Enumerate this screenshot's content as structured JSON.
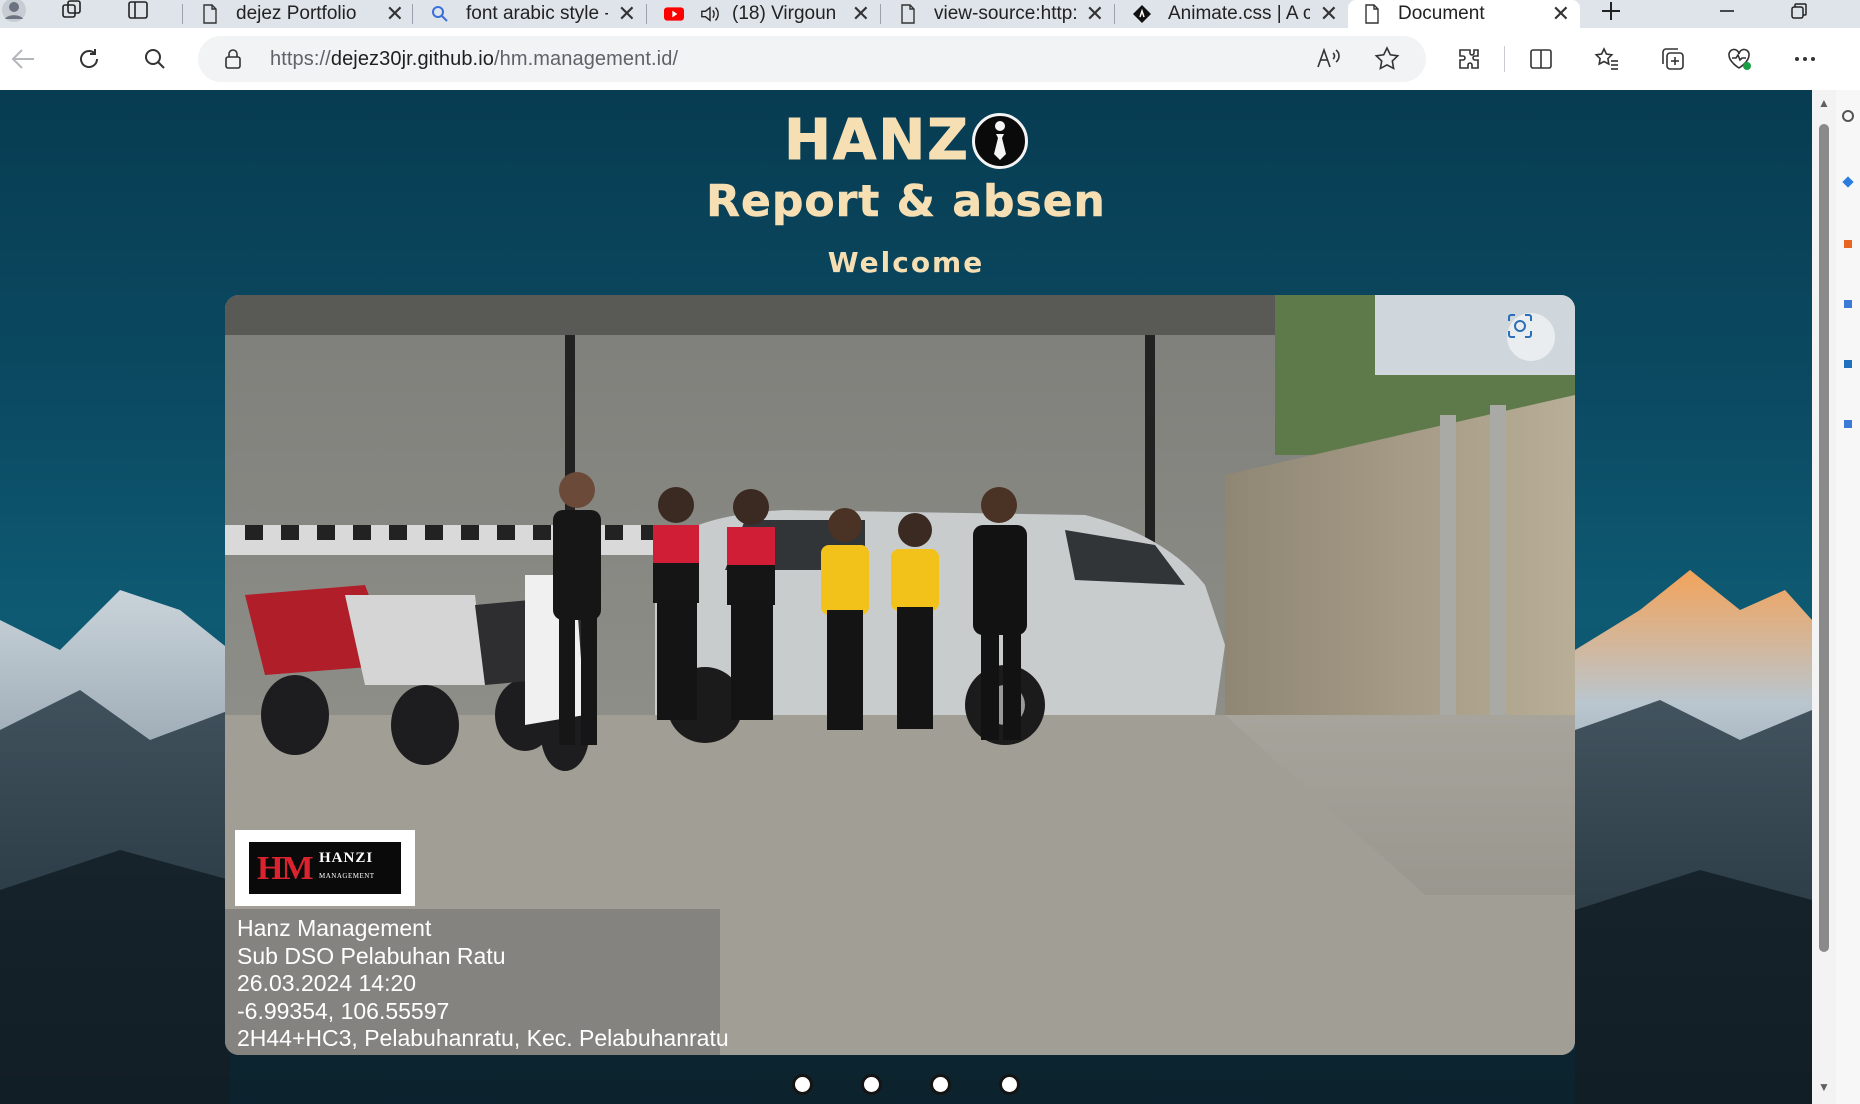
{
  "browser": {
    "tabs": [
      {
        "title": "dejez Portfolio",
        "icon": "page-icon"
      },
      {
        "title": "font arabic style -",
        "icon": "search-icon"
      },
      {
        "title": "(18) Virgoun",
        "icon": "youtube-icon",
        "audio": true
      },
      {
        "title": "view-source:http:",
        "icon": "page-icon"
      },
      {
        "title": "Animate.css | A c",
        "icon": "animate-icon"
      },
      {
        "title": "Document",
        "icon": "page-icon",
        "active": true
      }
    ],
    "url_scheme": "https://",
    "url_host": "dejez30jr.github.io",
    "url_path": "/hm.management.id/"
  },
  "page": {
    "logo_text": "HANZ",
    "subtitle": "Report & absen",
    "welcome": "Welcome",
    "carousel": {
      "stamp_logo_left": "HM",
      "stamp_logo_right": "HANZI",
      "stamp_logo_small": "MANAGEMENT",
      "stamp_lines": [
        "Hanz Management",
        "Sub DSO Pelabuhan Ratu",
        "26.03.2024 14:20",
        "-6.99354, 106.55597",
        "2H44+HC3, Pelabuhanratu, Kec. Pelabuhanratu"
      ],
      "dot_count": 4
    }
  },
  "colors": {
    "title": "#f7dfb4",
    "background_top": "#073c52",
    "background_mid": "#0e5a73"
  }
}
